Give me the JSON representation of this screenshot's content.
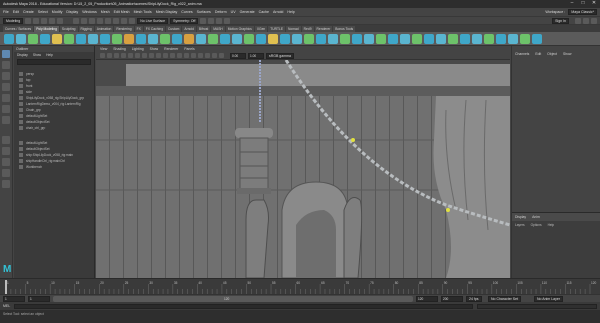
{
  "window": {
    "title": "Autodesk Maya 2018 - Educational Version: D:\\15_2_05_Production\\05_Animation\\scenes\\ShipLilyDock_Rig_v022_anim.ma",
    "controls": [
      "–",
      "□",
      "✕"
    ]
  },
  "menubar": {
    "items": [
      "File",
      "Edit",
      "Create",
      "Select",
      "Modify",
      "Display",
      "Windows",
      "Mesh",
      "Edit Mesh",
      "Mesh Tools",
      "Mesh Display",
      "Curves",
      "Surfaces",
      "Deform",
      "UV",
      "Generate",
      "Cache",
      "Arnold",
      "Help"
    ],
    "workspace_label": "Workspace :",
    "workspace_value": "Maya Classic*"
  },
  "statusline": {
    "mode": "Modeling",
    "live_surface": "No Live Surface",
    "symmetry": "Symmetry: Off",
    "sign_in": "Sign In"
  },
  "shelf": {
    "tabs": [
      "Curves / Surfaces",
      "Poly Modeling",
      "Sculpting",
      "Rigging",
      "Animation",
      "Rendering",
      "FX",
      "FX Caching",
      "Custom",
      "Arnold",
      "Bifrost",
      "MASH",
      "Motion Graphics",
      "XGen",
      "TURTLE",
      "Nomad",
      "Red9",
      "Renderer",
      "Bonus Tools"
    ],
    "active_tab": "Poly Modeling",
    "icon_colors": [
      "#3fa7c9",
      "#5ab5d0",
      "#6dc26a",
      "#3fa7c9",
      "#e0c050",
      "#6dc26a",
      "#3fa7c9",
      "#5ab5d0",
      "#3fa7c9",
      "#6dc26a",
      "#d8a040",
      "#3fa7c9",
      "#5ab5d0",
      "#6dc26a",
      "#3fa7c9",
      "#d8a040",
      "#5ab5d0",
      "#6dc26a",
      "#3fa7c9",
      "#5ab5d0",
      "#6dc26a",
      "#3fa7c9",
      "#e0c050",
      "#3fa7c9",
      "#5ab5d0",
      "#6dc26a",
      "#3fa7c9",
      "#5ab5d0",
      "#6dc26a",
      "#3fa7c9",
      "#5ab5d0",
      "#6dc26a",
      "#3fa7c9",
      "#5ab5d0",
      "#6dc26a",
      "#3fa7c9",
      "#5ab5d0",
      "#6dc26a",
      "#3fa7c9",
      "#5ab5d0",
      "#6dc26a",
      "#3fa7c9",
      "#5ab5d0",
      "#6dc26a",
      "#3fa7c9"
    ]
  },
  "outliner": {
    "title": "Outliner",
    "menu": [
      "Display",
      "Show",
      "Help"
    ],
    "rows": [
      "",
      "persp",
      "top",
      "front",
      "side",
      "ShipLilyDock_v058_rig:ShipLilyDock_grp",
      "LanternRigDemo_v004_rig:LanternRig",
      "Chain_grp",
      "defaultLightSet",
      "defaultObjectSet",
      "chair_ctrl_grp",
      "",
      "",
      "defaultLightSet",
      "defaultObjectSet",
      "ship:ShipLilyDock_v058_rig:main",
      "shipHandleCtrl_rig:mainCtrl",
      "Workbench"
    ]
  },
  "viewport": {
    "menu": [
      "View",
      "Shading",
      "Lighting",
      "Show",
      "Renderer",
      "Panels"
    ],
    "camera_field": "0.00",
    "scale_field": "1.00",
    "color_space": "sRGB gamma"
  },
  "channelbox": {
    "tabs": [
      "Channels",
      "Edit",
      "Object",
      "Show"
    ]
  },
  "layers": {
    "tabs": [
      "Display",
      "Anim"
    ],
    "menu": [
      "Layers",
      "Options",
      "Help"
    ]
  },
  "timeline": {
    "ticks": [
      "1",
      "5",
      "10",
      "15",
      "20",
      "25",
      "30",
      "35",
      "40",
      "45",
      "50",
      "55",
      "60",
      "65",
      "70",
      "75",
      "80",
      "85",
      "90",
      "95",
      "100",
      "105",
      "110",
      "115",
      "120"
    ],
    "current_frame": "1"
  },
  "rangebar": {
    "start": "1",
    "anim_start": "1",
    "range_label": "120",
    "anim_end": "120",
    "end": "200",
    "character_set": "No Character Set",
    "anim_layer": "No Anim Layer",
    "fps": "24 fps"
  },
  "cmdline": {
    "lang": "MEL"
  },
  "helpline": {
    "text": "Select Tool: select an object"
  }
}
